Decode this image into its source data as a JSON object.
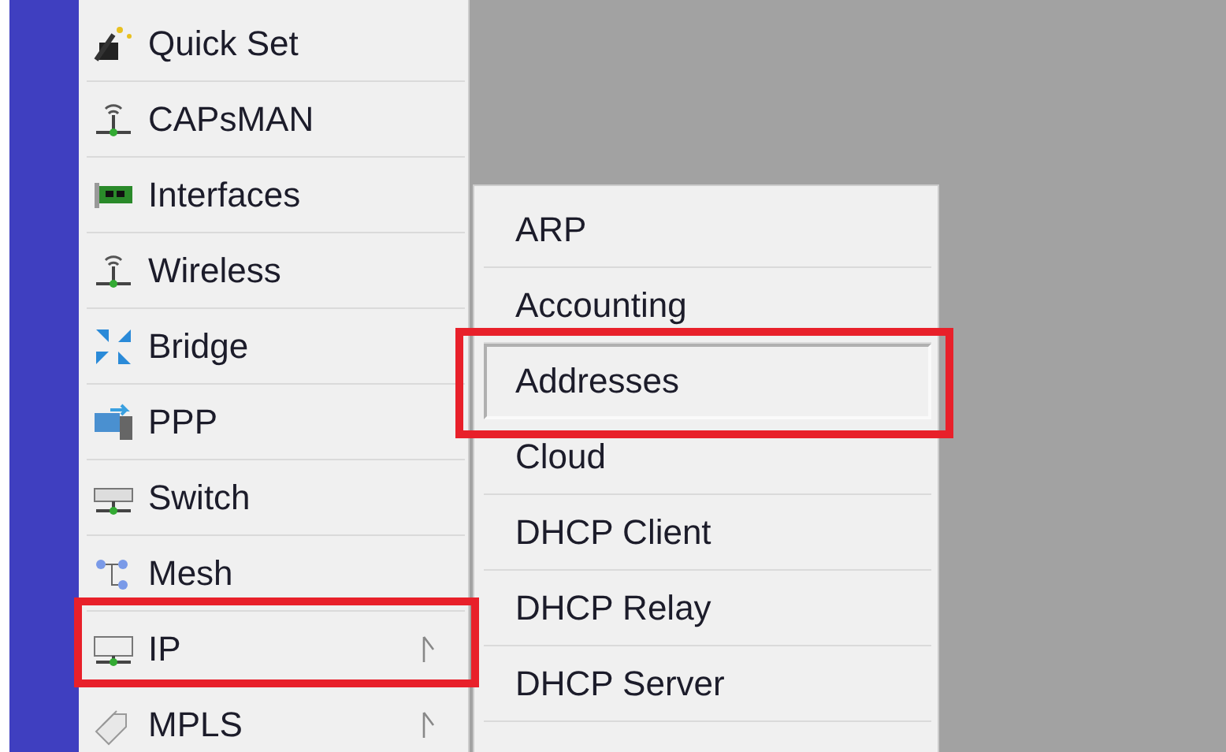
{
  "sidebar": {
    "items": [
      {
        "label": "Quick Set",
        "submenu": false,
        "highlighted": false
      },
      {
        "label": "CAPsMAN",
        "submenu": false,
        "highlighted": false
      },
      {
        "label": "Interfaces",
        "submenu": false,
        "highlighted": false
      },
      {
        "label": "Wireless",
        "submenu": false,
        "highlighted": false
      },
      {
        "label": "Bridge",
        "submenu": false,
        "highlighted": false
      },
      {
        "label": "PPP",
        "submenu": false,
        "highlighted": false
      },
      {
        "label": "Switch",
        "submenu": false,
        "highlighted": false
      },
      {
        "label": "Mesh",
        "submenu": false,
        "highlighted": false
      },
      {
        "label": "IP",
        "submenu": true,
        "highlighted": true
      },
      {
        "label": "MPLS",
        "submenu": true,
        "highlighted": false
      }
    ]
  },
  "submenu": {
    "items": [
      {
        "label": "ARP",
        "selected": false,
        "highlighted": false
      },
      {
        "label": "Accounting",
        "selected": false,
        "highlighted": false
      },
      {
        "label": "Addresses",
        "selected": true,
        "highlighted": true
      },
      {
        "label": "Cloud",
        "selected": false,
        "highlighted": false
      },
      {
        "label": "DHCP Client",
        "selected": false,
        "highlighted": false
      },
      {
        "label": "DHCP Relay",
        "selected": false,
        "highlighted": false
      },
      {
        "label": "DHCP Server",
        "selected": false,
        "highlighted": false
      }
    ]
  }
}
